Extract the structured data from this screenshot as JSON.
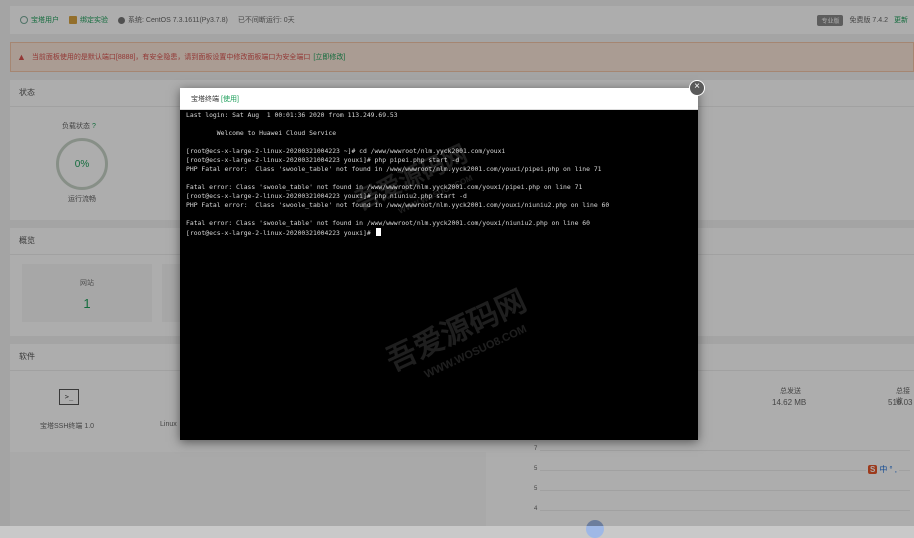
{
  "topbar": {
    "items": [
      "宝塔用户",
      "绑定实验",
      "系统: CentOS 7.3.1611(Py3.7.8)",
      "已不间断运行: 0天"
    ],
    "right_badge": "专业版",
    "version": "免费版 7.4.2",
    "update": "更新"
  },
  "alert": {
    "text": "当前面板使用的是默认端口[8888]，有安全隐患，请到面板设置中修改面板端口为安全端口",
    "link": "[立即修改]"
  },
  "status_panel": {
    "title": "状态",
    "load_label": "负载状态",
    "load_value": "0%",
    "load_status": "运行流畅"
  },
  "overview_panel": {
    "title": "概览",
    "site_label": "网站",
    "site_value": "1"
  },
  "software_panel": {
    "title": "软件",
    "terminal_label": "宝塔SSH终端 1.0",
    "linux_label": "Linux"
  },
  "traffic": {
    "up_label": "总发送",
    "up_value": "14.62 MB",
    "down_label": "总接收",
    "down_value": "518.03"
  },
  "chart_ticks": [
    "7",
    "5",
    "5",
    "4"
  ],
  "ime": {
    "brand": "S",
    "mode": "中",
    "extra": "° ,"
  },
  "modal": {
    "title": "宝塔终端",
    "hint": "[使用]",
    "close": "×",
    "lines": [
      "Last login: Sat Aug  1 00:01:36 2020 from 113.249.69.53",
      "",
      "        Welcome to Huawei Cloud Service",
      "",
      "[root@ecs-x-large-2-linux-20200321004223 ~]# cd /www/wwwroot/nlm.yyck2001.com/youxi",
      "[root@ecs-x-large-2-linux-20200321004223 youxi]# php pipei.php start -d",
      "PHP Fatal error:  Class 'swoole_table' not found in /www/wwwroot/nlm.yyck2001.com/youxi/pipei.php on line 71",
      "",
      "Fatal error: Class 'swoole_table' not found in /www/wwwroot/nlm.yyck2001.com/youxi/pipei.php on line 71",
      "[root@ecs-x-large-2-linux-20200321004223 youxi]# php niuniu2.php start -d",
      "PHP Fatal error:  Class 'swoole_table' not found in /www/wwwroot/nlm.yyck2001.com/youxi/niuniu2.php on line 60",
      "",
      "Fatal error: Class 'swoole_table' not found in /www/wwwroot/nlm.yyck2001.com/youxi/niuniu2.php on line 60"
    ],
    "prompt": "[root@ecs-x-large-2-linux-20200321004223 youxi]# "
  },
  "watermarks": [
    "吾爱源码网",
    "WWW.WOSUO8.COM",
    "吾爱源码网",
    "WWW.WOSUO8.COM"
  ]
}
